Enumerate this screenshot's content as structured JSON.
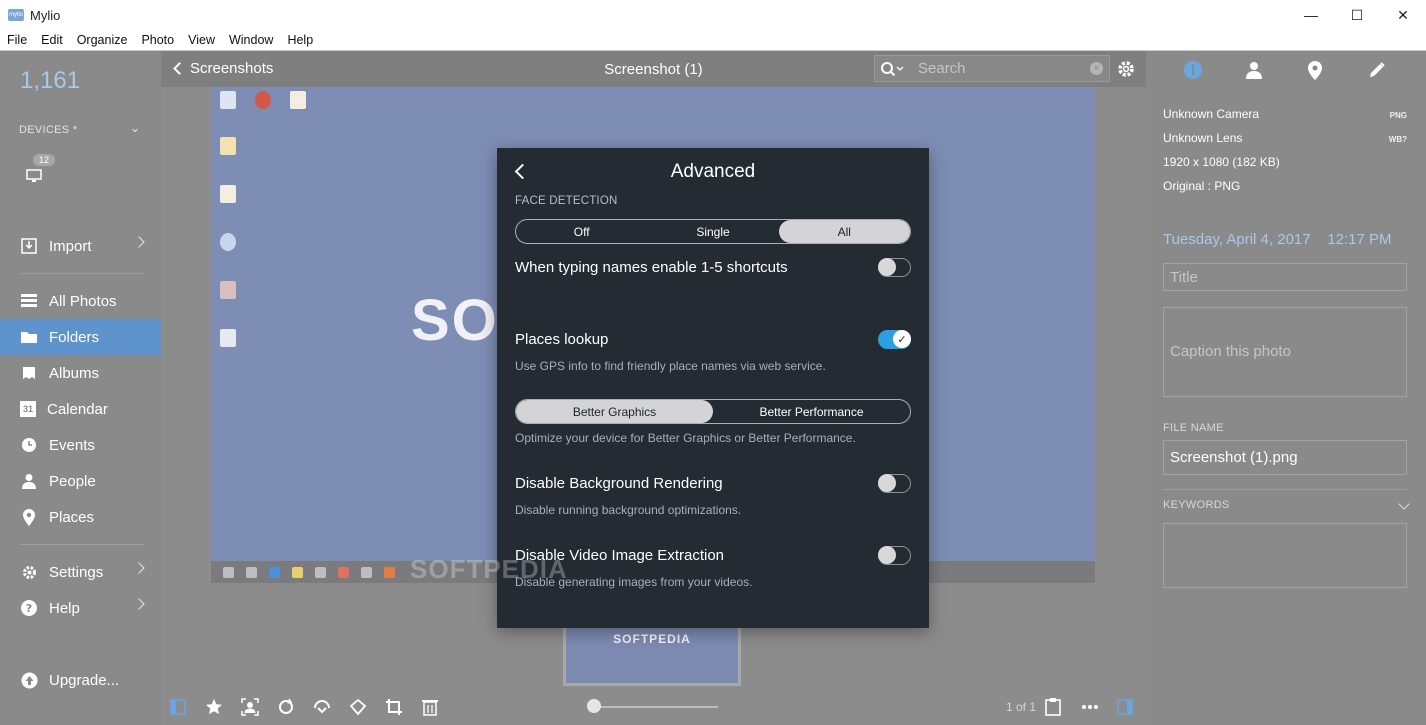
{
  "window": {
    "title": "Mylio",
    "logo_text": "mylio",
    "controls": {
      "minimize": "—",
      "maximize": "☐",
      "close": "✕"
    }
  },
  "menu": [
    "File",
    "Edit",
    "Organize",
    "Photo",
    "View",
    "Window",
    "Help"
  ],
  "sidebar": {
    "count": "1,161",
    "devices_label": "DEVICES *",
    "device_badge": "12",
    "items": [
      {
        "label": "Import",
        "icon": "import-icon"
      },
      {
        "label": "All Photos",
        "icon": "grid-icon"
      },
      {
        "label": "Folders",
        "icon": "folder-icon"
      },
      {
        "label": "Albums",
        "icon": "album-icon"
      },
      {
        "label": "Calendar",
        "icon": "calendar-icon",
        "glyph": "31"
      },
      {
        "label": "Events",
        "icon": "clock-icon"
      },
      {
        "label": "People",
        "icon": "person-icon"
      },
      {
        "label": "Places",
        "icon": "pin-icon"
      },
      {
        "label": "Settings",
        "icon": "gear-icon"
      },
      {
        "label": "Help",
        "icon": "help-icon"
      },
      {
        "label": "Upgrade...",
        "icon": "upgrade-icon"
      }
    ]
  },
  "viewer": {
    "back_label": "Screenshots",
    "title": "Screenshot (1)",
    "search_placeholder": "Search",
    "search_clear": "×",
    "page_count": "1 of 1",
    "preview": {
      "logo": "SO",
      "thumb_logo": "SOFTPEDIA"
    }
  },
  "info": {
    "camera": "Unknown Camera",
    "lens": "Unknown Lens",
    "dimensions": "1920 x 1080 (182 KB)",
    "original": "Original : PNG",
    "tag_format": "PNG",
    "tag_wb": "WB?",
    "date": "Tuesday, April 4, 2017",
    "time": "12:17 PM",
    "title_placeholder": "Title",
    "caption_placeholder": "Caption this photo",
    "file_name_label": "FILE NAME",
    "file_name": "Screenshot (1).png",
    "keywords_label": "KEYWORDS"
  },
  "modal": {
    "title": "Advanced",
    "face_detection_label": "FACE DETECTION",
    "face_options": [
      "Off",
      "Single",
      "All"
    ],
    "face_selected": "All",
    "shortcuts_label": "When typing names enable 1-5 shortcuts",
    "shortcuts_on": false,
    "places_label": "Places lookup",
    "places_desc": "Use GPS info to find friendly place names via web service.",
    "places_on": true,
    "perf_options": [
      "Better Graphics",
      "Better Performance"
    ],
    "perf_selected": "Better Graphics",
    "perf_desc": "Optimize your device for Better Graphics or Better Performance.",
    "bg_label": "Disable Background Rendering",
    "bg_desc": "Disable running background optimizations.",
    "bg_on": false,
    "video_label": "Disable Video Image Extraction",
    "video_desc": "Disable generating images from your videos.",
    "video_on": false,
    "check_glyph": "✓"
  },
  "watermark": "SOFTPEDIA",
  "colors": {
    "accent": "#5f93cd",
    "link": "#a9c8ea",
    "toggle_on": "#2b9fe0",
    "modal_bg": "#252b33"
  }
}
